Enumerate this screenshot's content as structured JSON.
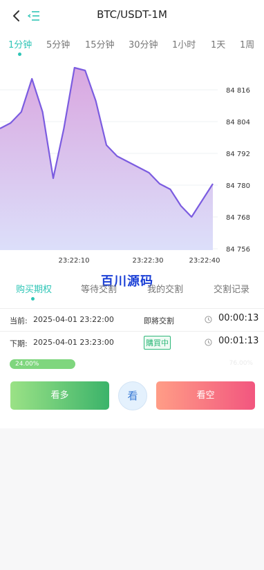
{
  "header": {
    "title": "BTC/USDT-1M"
  },
  "interval_tabs": [
    {
      "label": "1分钟",
      "active": true
    },
    {
      "label": "5分钟",
      "active": false
    },
    {
      "label": "15分钟",
      "active": false
    },
    {
      "label": "30分钟",
      "active": false
    },
    {
      "label": "1小时",
      "active": false
    },
    {
      "label": "1天",
      "active": false
    },
    {
      "label": "1周",
      "active": false
    }
  ],
  "chart_data": {
    "type": "area",
    "price_ticks": [
      "84 816",
      "84 804",
      "84 792",
      "84 780",
      "84 768",
      "84 756"
    ],
    "time_ticks": [
      "23:22:10",
      "23:22:30",
      "23:22:40"
    ],
    "ylim": [
      84756,
      84822
    ],
    "series": [
      {
        "x": [
          0,
          3,
          6,
          9,
          12,
          15,
          18,
          21,
          24,
          27,
          30,
          33,
          36,
          39,
          42,
          45,
          48,
          51,
          54,
          57,
          60
        ],
        "values": [
          84800,
          84802,
          84806,
          84818,
          84806,
          84782,
          84800,
          84822,
          84821,
          84810,
          84794,
          84790,
          84788,
          84786,
          84784,
          84780,
          84778,
          84772,
          84768,
          84774,
          84780
        ]
      }
    ],
    "line_color": "#7b5ce0",
    "fill_top": "#d9a7e0",
    "fill_bottom": "#dcdffa",
    "grid": true
  },
  "watermark": "百川源码",
  "order_tabs": [
    {
      "label": "购买期权",
      "active": true
    },
    {
      "label": "等待交割",
      "active": false
    },
    {
      "label": "我的交割",
      "active": false
    },
    {
      "label": "交割记录",
      "active": false
    }
  ],
  "current": {
    "label": "当前:",
    "time": "2025-04-01 23:22:00",
    "status": "即將交割",
    "countdown": "00:00:13"
  },
  "next": {
    "label": "下期:",
    "time": "2025-04-01 23:23:00",
    "status": "購買中",
    "countdown": "00:01:13"
  },
  "progress": {
    "buy_percent": 24,
    "buy_label": "24.00%",
    "sell_label": "76.00%"
  },
  "actions": {
    "buy_label": "看多",
    "middle_label": "看",
    "sell_label": "看空"
  },
  "colors": {
    "accent": "#2ec5b6",
    "buy": "#3bb36a",
    "sell": "#f2567f"
  }
}
